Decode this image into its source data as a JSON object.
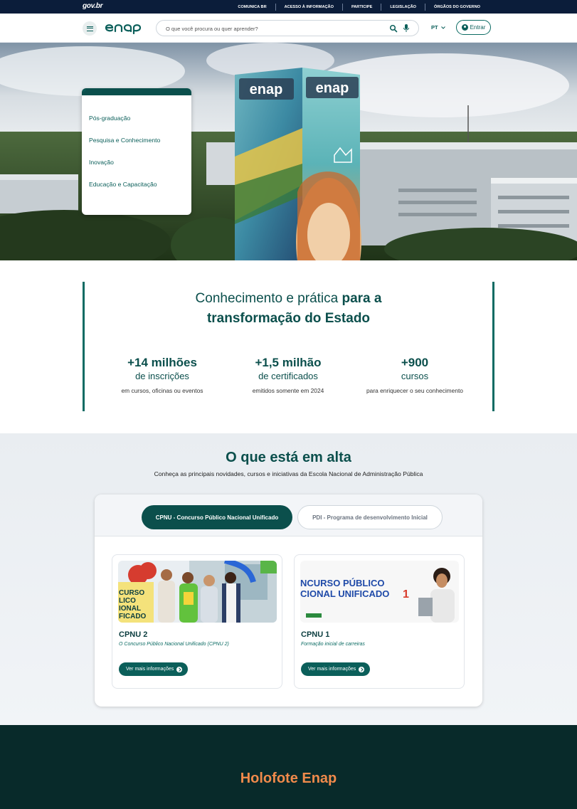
{
  "gov_bar": {
    "logo": "gov.br",
    "links": [
      "COMUNICA BR",
      "ACESSO À INFORMAÇÃO",
      "PARTICIPE",
      "LEGISLAÇÃO",
      "ÓRGÃOS DO GOVERNO"
    ]
  },
  "header": {
    "brand": "enap",
    "search_placeholder": "O que você procura ou quer aprender?",
    "language": "PT",
    "login_label": "Entrar"
  },
  "hero": {
    "menu_items": [
      {
        "label": "Pós-graduação"
      },
      {
        "label": "Pesquisa e Conhecimento"
      },
      {
        "label": "Inovação"
      },
      {
        "label": "Educação e Capacitação"
      }
    ],
    "tower_text": "enap"
  },
  "stats": {
    "headline_1": "Conhecimento e prática",
    "headline_2": "para a",
    "headline_3": "transformação do Estado",
    "items": [
      {
        "big": "+14 milhões",
        "mid": "de inscrições",
        "small": "em cursos, oficinas ou eventos"
      },
      {
        "big": "+1,5 milhão",
        "mid": "de certificados",
        "small": "emitidos somente em 2024"
      },
      {
        "big": "+900",
        "mid": "cursos",
        "small": "para enriquecer o seu conhecimento"
      }
    ]
  },
  "trending": {
    "title": "O que está em alta",
    "subtitle": "Conheça as principais novidades, cursos e iniciativas da Escola Nacional de Administração Pública",
    "tabs": [
      {
        "label": "CPNU - Concurso Público Nacional Unificado",
        "active": true
      },
      {
        "label": "PDI - Programa de desenvolvimento Inicial",
        "active": false
      }
    ],
    "cards": [
      {
        "title": "CPNU 2",
        "desc": "O Concurso Público Nacional Unificado (CPNU 2)",
        "button": "Ver mais informações",
        "img_text_1": "CURSO",
        "img_text_2": "LICO",
        "img_text_3": "IONAL",
        "img_text_4": "FICADO"
      },
      {
        "title": "CPNU 1",
        "desc": "Formação inicial de carreiras",
        "button": "Ver mais informações",
        "img_text_1": "NCURSO PÚBLICO",
        "img_text_2": "CIONAL UNIFICADO"
      }
    ]
  },
  "holofote": {
    "title": "Holofote Enap"
  },
  "colors": {
    "primary": "#0b4f4c",
    "accent": "#f08a4b",
    "gov_bar": "#0b1d3a"
  }
}
